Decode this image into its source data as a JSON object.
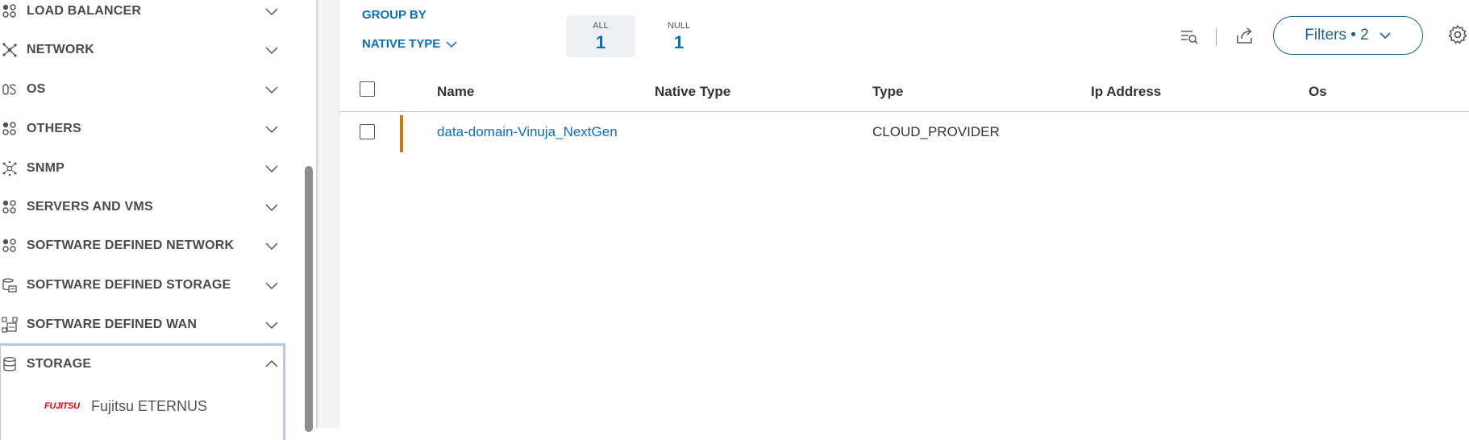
{
  "sidebar": {
    "categories": [
      {
        "label": "LOAD BALANCER",
        "icon": "dots-cluster-icon"
      },
      {
        "label": "NETWORK",
        "icon": "network-node-icon"
      },
      {
        "label": "OS",
        "icon": "os-icon"
      },
      {
        "label": "OTHERS",
        "icon": "dots-cluster-icon"
      },
      {
        "label": "SNMP",
        "icon": "snmp-icon"
      },
      {
        "label": "SERVERS AND VMS",
        "icon": "dots-cluster-icon"
      },
      {
        "label": "SOFTWARE DEFINED NETWORK",
        "icon": "dots-cluster-icon"
      },
      {
        "label": "SOFTWARE DEFINED STORAGE",
        "icon": "sds-icon"
      },
      {
        "label": "SOFTWARE DEFINED WAN",
        "icon": "sdwan-icon"
      },
      {
        "label": "STORAGE",
        "icon": "database-icon",
        "expanded": true
      }
    ],
    "storage_children": [
      {
        "brand": "FUJITSU",
        "label": "Fujitsu ETERNUS"
      }
    ]
  },
  "main": {
    "group_by": {
      "title": "GROUP BY",
      "selected": "NATIVE TYPE"
    },
    "counts": [
      {
        "label": "ALL",
        "value": "1",
        "active": true
      },
      {
        "label": "NULL",
        "value": "1",
        "active": false
      }
    ],
    "toolbar": {
      "filters_label": "Filters • 2",
      "icons": [
        "search-list-icon",
        "export-icon",
        "settings-gear-icon"
      ]
    },
    "table": {
      "columns": [
        "Name",
        "Native Type",
        "Type",
        "Ip Address",
        "Os"
      ],
      "rows": [
        {
          "name": "data-domain-Vinuja_NextGen",
          "native_type": "",
          "type": "CLOUD_PROVIDER",
          "ip_address": "",
          "os": "",
          "status_color": "#c87a0e"
        }
      ]
    }
  },
  "colors": {
    "accent": "#0a6ebd",
    "filters_border": "#1d5f8c",
    "status_bar": "#c87a0e",
    "selected_box_border": "#b7c8d9"
  }
}
